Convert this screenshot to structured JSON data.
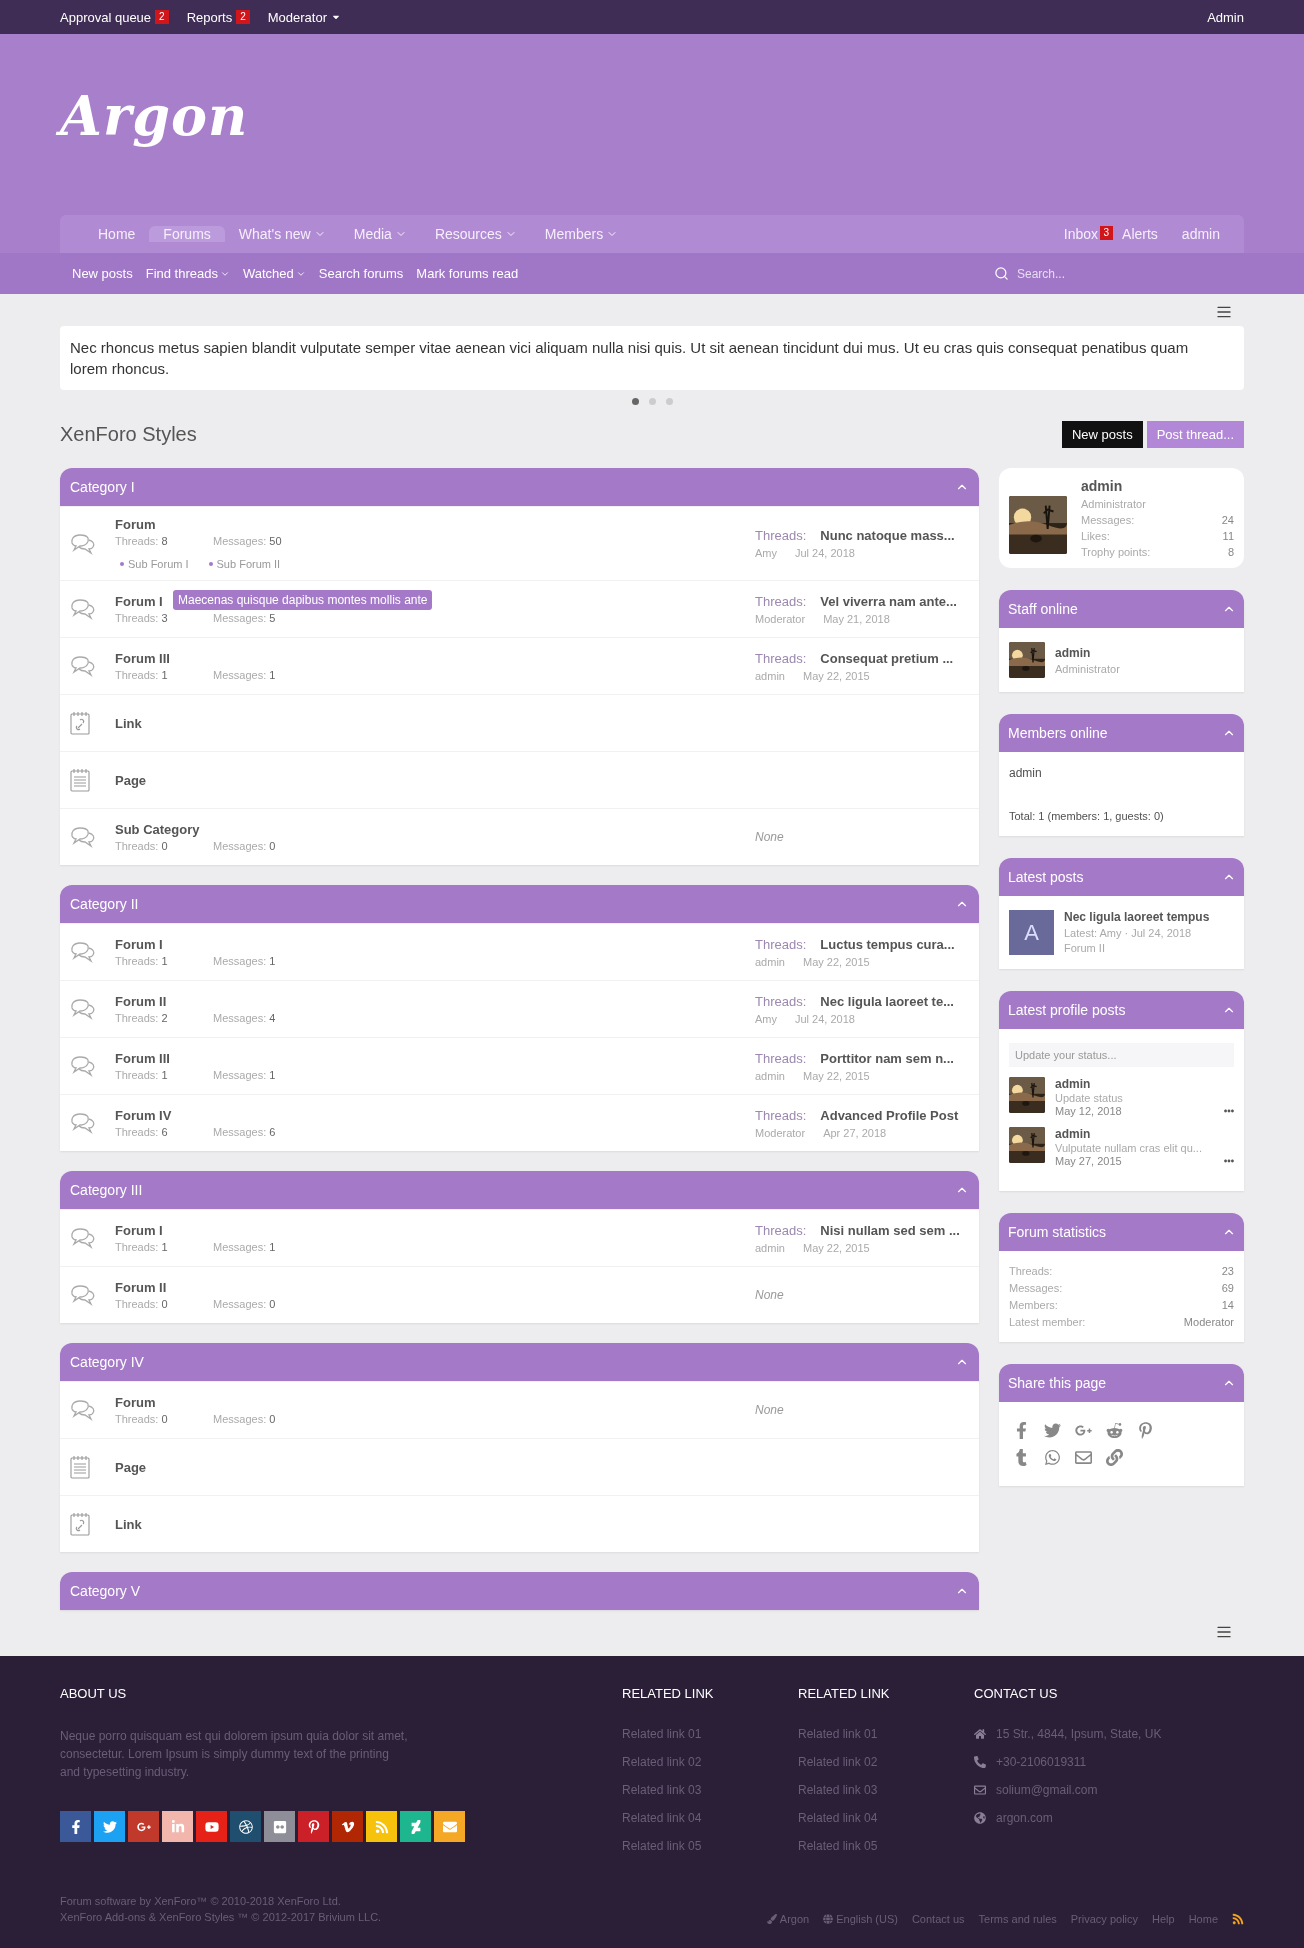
{
  "top_bar": {
    "links": [
      {
        "label": "Approval queue",
        "badge": "2",
        "dropdown": false
      },
      {
        "label": "Reports",
        "badge": "2",
        "dropdown": false
      },
      {
        "label": "Moderator",
        "dropdown": true
      }
    ],
    "user": "Admin"
  },
  "logo": "Argon",
  "nav": {
    "tabs": [
      {
        "label": "Home",
        "selected": false,
        "dropdown": false
      },
      {
        "label": "Forums",
        "selected": true,
        "dropdown": false
      },
      {
        "label": "What's new",
        "selected": false,
        "dropdown": true
      },
      {
        "label": "Media",
        "selected": false,
        "dropdown": true
      },
      {
        "label": "Resources",
        "selected": false,
        "dropdown": true
      },
      {
        "label": "Members",
        "selected": false,
        "dropdown": true
      }
    ],
    "right": [
      {
        "label": "Inbox",
        "badge": "3"
      },
      {
        "label": "Alerts"
      },
      {
        "label": "admin"
      }
    ]
  },
  "subnav": {
    "links": [
      {
        "label": "New posts",
        "dropdown": false
      },
      {
        "label": "Find threads",
        "dropdown": true
      },
      {
        "label": "Watched",
        "dropdown": true
      },
      {
        "label": "Search forums",
        "dropdown": false
      },
      {
        "label": "Mark forums read",
        "dropdown": false
      }
    ],
    "search_placeholder": "Search..."
  },
  "notice": {
    "text": "Nec rhoncus metus sapien blandit vulputate semper vitae aenean vici aliquam nulla nisi quis. Ut sit aenean tincidunt dui mus. Ut eu cras quis consequat penatibus quam lorem rhoncus.",
    "dots": [
      {
        "selected": true
      },
      {
        "selected": false
      },
      {
        "selected": false
      }
    ]
  },
  "page_title": "XenForo Styles",
  "actions": [
    {
      "label": "New posts",
      "kind": "dark"
    },
    {
      "label": "Post thread...",
      "kind": "accent"
    }
  ],
  "categories": [
    {
      "title": "Category I",
      "nodes": [
        {
          "kind": "forum",
          "title": "Forum",
          "stats": [
            {
              "label": "Threads:",
              "value": "8"
            },
            {
              "label": "Messages:",
              "value": "50"
            }
          ],
          "subforums": [
            "Sub Forum I",
            "Sub Forum II"
          ],
          "latest": {
            "prefix": "Threads:",
            "title": "Nunc natoque mass...",
            "user": "Amy",
            "date": "Jul 24, 2018"
          }
        },
        {
          "kind": "forum",
          "title": "Forum I",
          "tooltip": "Maecenas quisque dapibus montes mollis ante",
          "stats": [
            {
              "label": "Threads:",
              "value": "3"
            },
            {
              "label": "Messages:",
              "value": "5"
            }
          ],
          "latest": {
            "prefix": "Threads:",
            "title": "Vel viverra nam ante...",
            "user": "Moderator",
            "date": "May 21, 2018"
          }
        },
        {
          "kind": "forum",
          "title": "Forum III",
          "stats": [
            {
              "label": "Threads:",
              "value": "1"
            },
            {
              "label": "Messages:",
              "value": "1"
            }
          ],
          "latest": {
            "prefix": "Threads:",
            "title": "Consequat pretium ...",
            "user": "admin",
            "date": "May 22, 2015"
          }
        },
        {
          "kind": "link",
          "title": "Link"
        },
        {
          "kind": "page",
          "title": "Page"
        },
        {
          "kind": "forum",
          "title": "Sub Category",
          "stats": [
            {
              "label": "Threads:",
              "value": "0"
            },
            {
              "label": "Messages:",
              "value": "0"
            }
          ],
          "none": "None"
        }
      ]
    },
    {
      "title": "Category II",
      "nodes": [
        {
          "kind": "forum",
          "title": "Forum I",
          "stats": [
            {
              "label": "Threads:",
              "value": "1"
            },
            {
              "label": "Messages:",
              "value": "1"
            }
          ],
          "latest": {
            "prefix": "Threads:",
            "title": "Luctus tempus cura...",
            "user": "admin",
            "date": "May 22, 2015"
          }
        },
        {
          "kind": "forum",
          "title": "Forum II",
          "stats": [
            {
              "label": "Threads:",
              "value": "2"
            },
            {
              "label": "Messages:",
              "value": "4"
            }
          ],
          "latest": {
            "prefix": "Threads:",
            "title": "Nec ligula laoreet te...",
            "user": "Amy",
            "date": "Jul 24, 2018"
          }
        },
        {
          "kind": "forum",
          "title": "Forum III",
          "stats": [
            {
              "label": "Threads:",
              "value": "1"
            },
            {
              "label": "Messages:",
              "value": "1"
            }
          ],
          "latest": {
            "prefix": "Threads:",
            "title": "Porttitor nam sem n...",
            "user": "admin",
            "date": "May 22, 2015"
          }
        },
        {
          "kind": "forum",
          "title": "Forum IV",
          "stats": [
            {
              "label": "Threads:",
              "value": "6"
            },
            {
              "label": "Messages:",
              "value": "6"
            }
          ],
          "latest": {
            "prefix": "Threads:",
            "title": "Advanced Profile Post",
            "user": "Moderator",
            "date": "Apr 27, 2018"
          }
        }
      ]
    },
    {
      "title": "Category III",
      "nodes": [
        {
          "kind": "forum",
          "title": "Forum I",
          "stats": [
            {
              "label": "Threads:",
              "value": "1"
            },
            {
              "label": "Messages:",
              "value": "1"
            }
          ],
          "latest": {
            "prefix": "Threads:",
            "title": "Nisi nullam sed sem ...",
            "user": "admin",
            "date": "May 22, 2015"
          }
        },
        {
          "kind": "forum",
          "title": "Forum II",
          "stats": [
            {
              "label": "Threads:",
              "value": "0"
            },
            {
              "label": "Messages:",
              "value": "0"
            }
          ],
          "none": "None"
        }
      ]
    },
    {
      "title": "Category IV",
      "nodes": [
        {
          "kind": "forum",
          "title": "Forum",
          "stats": [
            {
              "label": "Threads:",
              "value": "0"
            },
            {
              "label": "Messages:",
              "value": "0"
            }
          ],
          "none": "None"
        },
        {
          "kind": "page",
          "title": "Page"
        },
        {
          "kind": "link",
          "title": "Link"
        }
      ]
    },
    {
      "title": "Category V"
    }
  ],
  "sidebar": {
    "profile": {
      "name": "admin",
      "role": "Administrator",
      "stats": [
        {
          "label": "Messages:",
          "value": "24"
        },
        {
          "label": "Likes:",
          "value": "11"
        },
        {
          "label": "Trophy points:",
          "value": "8"
        }
      ]
    },
    "staff": {
      "title": "Staff online",
      "name": "admin",
      "role": "Administrator"
    },
    "members": {
      "title": "Members online",
      "list": "admin",
      "total": "Total: 1 (members: 1, guests: 0)"
    },
    "latest_posts": {
      "title": "Latest posts",
      "letter": "A",
      "post": "Nec ligula laoreet tempus",
      "meta": "Latest: Amy · Jul 24, 2018",
      "forum": "Forum II"
    },
    "profile_posts": {
      "title": "Latest profile posts",
      "placeholder": "Update your status...",
      "posts": [
        {
          "name": "admin",
          "text": "Update status",
          "date": "May 12, 2018"
        },
        {
          "name": "admin",
          "text": "Vulputate nullam cras elit qu...",
          "date": "May 27, 2015"
        }
      ]
    },
    "statistics": {
      "title": "Forum statistics",
      "rows": [
        {
          "label": "Threads:",
          "value": "23"
        },
        {
          "label": "Messages:",
          "value": "69"
        },
        {
          "label": "Members:",
          "value": "14"
        },
        {
          "label": "Latest member:",
          "value": "Moderator"
        }
      ]
    },
    "share": {
      "title": "Share this page",
      "icons": [
        {
          "kind": "facebook"
        },
        {
          "kind": "twitter"
        },
        {
          "kind": "google"
        },
        {
          "kind": "reddit"
        },
        {
          "kind": "pinterest"
        },
        {
          "kind": "tumblr"
        },
        {
          "kind": "whatsapp"
        },
        {
          "kind": "email"
        },
        {
          "kind": "link"
        }
      ]
    }
  },
  "footer": {
    "about": {
      "title": "ABOUT US",
      "text": "Neque porro quisquam est qui dolorem ipsum quia dolor sit amet, consectetur. Lorem Ipsum is simply dummy text of the printing and typesetting industry."
    },
    "social": [
      {
        "kind": "facebook",
        "color": "#3b5998"
      },
      {
        "kind": "twitter",
        "color": "#1da1f2"
      },
      {
        "kind": "google",
        "color": "#c0392b"
      },
      {
        "kind": "linkedin",
        "color": "#f2b6ad"
      },
      {
        "kind": "youtube",
        "color": "#e62117"
      },
      {
        "kind": "dribbble",
        "color": "#1f4e6e"
      },
      {
        "kind": "flickr",
        "color": "#8e8e99"
      },
      {
        "kind": "pinterest",
        "color": "#cb2027"
      },
      {
        "kind": "vimeo",
        "color": "#b12704"
      },
      {
        "kind": "rss",
        "color": "#f7c20c"
      },
      {
        "kind": "deviantart",
        "color": "#1db68e"
      },
      {
        "kind": "email",
        "color": "#f4a825"
      }
    ],
    "link_columns": [
      {
        "title": "RELATED LINK",
        "links": [
          "Related link 01",
          "Related link 02",
          "Related link 03",
          "Related link 04",
          "Related link 05"
        ]
      },
      {
        "title": "RELATED LINK",
        "links": [
          "Related link 01",
          "Related link 02",
          "Related link 03",
          "Related link 04",
          "Related link 05"
        ]
      }
    ],
    "contact": {
      "title": "CONTACT US",
      "items": [
        {
          "kind": "address",
          "text": "15 Str., 4844, Ipsum, State, UK"
        },
        {
          "kind": "phone",
          "text": "+30-2106019311"
        },
        {
          "kind": "email",
          "text": "solium@gmail.com"
        },
        {
          "kind": "web",
          "text": "argon.com"
        }
      ]
    },
    "copyright": [
      "Forum software by XenForo™ © 2010-2018 XenForo Ltd.",
      "XenForo Add-ons & XenForo Styles ™ © 2012-2017 Brivium LLC."
    ],
    "links": [
      {
        "kind": "style",
        "label": "Argon"
      },
      {
        "kind": "language",
        "label": "English (US)"
      },
      {
        "kind": "plain",
        "label": "Contact us"
      },
      {
        "kind": "plain",
        "label": "Terms and rules"
      },
      {
        "kind": "plain",
        "label": "Privacy policy"
      },
      {
        "kind": "plain",
        "label": "Help"
      },
      {
        "kind": "plain",
        "label": "Home"
      },
      {
        "kind": "rss"
      }
    ]
  }
}
